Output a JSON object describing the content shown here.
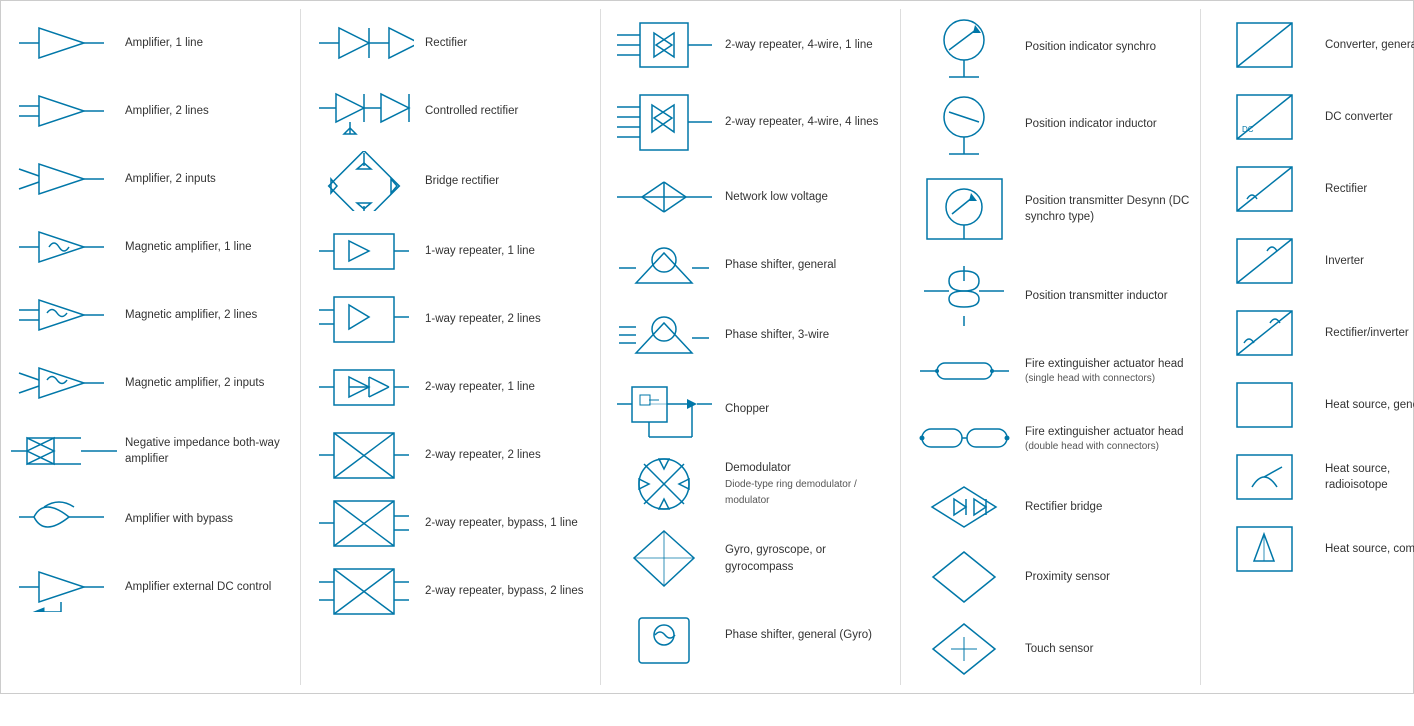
{
  "columns": [
    {
      "id": "col1",
      "items": [
        {
          "id": "amp1",
          "label": "Amplifier, 1 line",
          "sub": ""
        },
        {
          "id": "amp2",
          "label": "Amplifier, 2 lines",
          "sub": ""
        },
        {
          "id": "amp3",
          "label": "Amplifier, 2 inputs",
          "sub": ""
        },
        {
          "id": "mag1",
          "label": "Magnetic amplifier, 1 line",
          "sub": ""
        },
        {
          "id": "mag2",
          "label": "Magnetic amplifier, 2 lines",
          "sub": ""
        },
        {
          "id": "mag3",
          "label": "Magnetic amplifier, 2 inputs",
          "sub": ""
        },
        {
          "id": "neg1",
          "label": "Negative impedance both-way amplifier",
          "sub": ""
        },
        {
          "id": "byp1",
          "label": "Amplifier with bypass",
          "sub": ""
        },
        {
          "id": "ext1",
          "label": "Amplifier external DC control",
          "sub": ""
        }
      ]
    },
    {
      "id": "col2",
      "items": [
        {
          "id": "rec1",
          "label": "Rectifier",
          "sub": ""
        },
        {
          "id": "crec1",
          "label": "Controlled rectifier",
          "sub": ""
        },
        {
          "id": "brec1",
          "label": "Bridge rectifier",
          "sub": ""
        },
        {
          "id": "rep1",
          "label": "1-way repeater, 1 line",
          "sub": ""
        },
        {
          "id": "rep2",
          "label": "1-way repeater, 2 lines",
          "sub": ""
        },
        {
          "id": "rep3",
          "label": "2-way repeater, 1 line",
          "sub": ""
        },
        {
          "id": "rep4",
          "label": "2-way repeater, 2 lines",
          "sub": ""
        },
        {
          "id": "rep5",
          "label": "2-way repeater, bypass, 1 line",
          "sub": ""
        },
        {
          "id": "rep6",
          "label": "2-way repeater, bypass, 2 lines",
          "sub": ""
        }
      ]
    },
    {
      "id": "col3",
      "items": [
        {
          "id": "rpt1",
          "label": "2-way repeater, 4-wire, 1 line",
          "sub": ""
        },
        {
          "id": "rpt2",
          "label": "2-way repeater, 4-wire, 4 lines",
          "sub": ""
        },
        {
          "id": "nlv1",
          "label": "Network low voltage",
          "sub": ""
        },
        {
          "id": "psh1",
          "label": "Phase shifter, general",
          "sub": ""
        },
        {
          "id": "psh2",
          "label": "Phase shifter, 3-wire",
          "sub": ""
        },
        {
          "id": "chp1",
          "label": "Chopper",
          "sub": ""
        },
        {
          "id": "dem1",
          "label": "Demodulator",
          "sub": "Diode-type ring demodulator / modulator"
        },
        {
          "id": "gyr1",
          "label": "Gyro, gyroscope, or gyrocompass",
          "sub": ""
        },
        {
          "id": "psg1",
          "label": "Phase shifter, general (Gyro)",
          "sub": ""
        }
      ]
    },
    {
      "id": "col4",
      "items": [
        {
          "id": "pos1",
          "label": "Position indicator synchro",
          "sub": ""
        },
        {
          "id": "pos2",
          "label": "Position indicator inductor",
          "sub": ""
        },
        {
          "id": "ptr1",
          "label": "Position transmitter Desynn (DC synchro type)",
          "sub": ""
        },
        {
          "id": "ptr2",
          "label": "Position transmitter inductor",
          "sub": ""
        },
        {
          "id": "fir1",
          "label": "Fire extinguisher actuator head",
          "sub": "(single head with connectors)"
        },
        {
          "id": "fir2",
          "label": "Fire extinguisher actuator head",
          "sub": "(double head with connectors)"
        },
        {
          "id": "rbr1",
          "label": "Rectifier bridge",
          "sub": ""
        },
        {
          "id": "prx1",
          "label": "Proximity sensor",
          "sub": ""
        },
        {
          "id": "tch1",
          "label": "Touch sensor",
          "sub": ""
        }
      ]
    },
    {
      "id": "col5",
      "items": [
        {
          "id": "cvg1",
          "label": "Converter, general",
          "sub": ""
        },
        {
          "id": "dcc1",
          "label": "DC converter",
          "sub": ""
        },
        {
          "id": "rec2",
          "label": "Rectifier",
          "sub": ""
        },
        {
          "id": "inv1",
          "label": "Inverter",
          "sub": ""
        },
        {
          "id": "rci1",
          "label": "Rectifier/inverter",
          "sub": ""
        },
        {
          "id": "hsg1",
          "label": "Heat source, general",
          "sub": ""
        },
        {
          "id": "hsr1",
          "label": "Heat source, radioisotope",
          "sub": ""
        },
        {
          "id": "hsc1",
          "label": "Heat source, combustion",
          "sub": ""
        }
      ]
    }
  ]
}
